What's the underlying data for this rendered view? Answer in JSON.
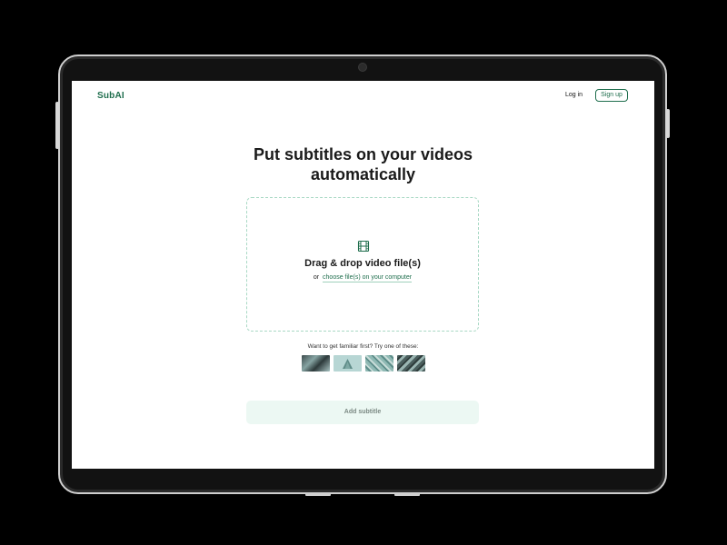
{
  "header": {
    "logo": "SubAI",
    "login_label": "Log in",
    "signup_label": "Sign up"
  },
  "main": {
    "title_line1": "Put subtitles on your videos",
    "title_line2": "automatically",
    "dropzone": {
      "title": "Drag & drop video file(s)",
      "or_text": "or",
      "choose_link": "choose file(s) on your computer",
      "icon": "film-icon"
    },
    "samples_prompt": "Want to get familiar first? Try one of these:",
    "add_button_label": "Add subtitle"
  },
  "colors": {
    "brand": "#1f6e4d",
    "dropzone_border": "#a8d8c4",
    "button_bg": "#ecf8f3"
  }
}
